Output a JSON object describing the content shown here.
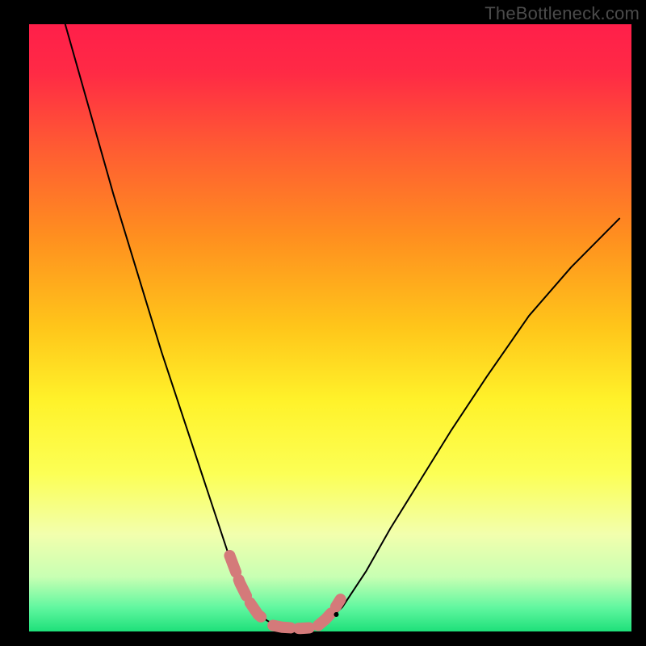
{
  "watermark": "TheBottleneck.com",
  "chart_data": {
    "type": "line",
    "title": "",
    "xlabel": "",
    "ylabel": "",
    "xlim": [
      0,
      100
    ],
    "ylim": [
      0,
      100
    ],
    "gradient_stops": [
      {
        "offset": 0.0,
        "color": "#ff1f4a"
      },
      {
        "offset": 0.08,
        "color": "#ff2a45"
      },
      {
        "offset": 0.2,
        "color": "#ff5a33"
      },
      {
        "offset": 0.35,
        "color": "#ff8f1f"
      },
      {
        "offset": 0.5,
        "color": "#ffc61a"
      },
      {
        "offset": 0.62,
        "color": "#fff22a"
      },
      {
        "offset": 0.74,
        "color": "#fcff55"
      },
      {
        "offset": 0.84,
        "color": "#f2ffad"
      },
      {
        "offset": 0.91,
        "color": "#c8ffb3"
      },
      {
        "offset": 0.96,
        "color": "#62f7a0"
      },
      {
        "offset": 1.0,
        "color": "#1ee07a"
      }
    ],
    "series": [
      {
        "name": "bottleneck-curve",
        "color": "#000000",
        "stroke_width": 2,
        "x": [
          6,
          10,
          14,
          18,
          22,
          26,
          29,
          31,
          33,
          35,
          36.5,
          38,
          39.5,
          41,
          43,
          45,
          47,
          49,
          52,
          56,
          60,
          65,
          70,
          76,
          83,
          90,
          98
        ],
        "y": [
          100,
          86,
          72,
          59,
          46,
          34,
          25,
          19,
          13,
          8,
          5,
          3,
          1.8,
          1.0,
          0.6,
          0.5,
          0.6,
          1.2,
          4,
          10,
          17,
          25,
          33,
          42,
          52,
          60,
          68
        ]
      },
      {
        "name": "pink-dash-left",
        "color": "#d47a7a",
        "stroke_width": 14,
        "dash": "22 10",
        "x": [
          33.3,
          35.0,
          36.5,
          38.0,
          39.5
        ],
        "y": [
          12.5,
          8.0,
          5.0,
          2.8,
          1.6
        ]
      },
      {
        "name": "pink-dash-bottom",
        "color": "#d47a7a",
        "stroke_width": 14,
        "dash": "22 10",
        "x": [
          40.5,
          42.0,
          43.5,
          45.0,
          46.5
        ],
        "y": [
          1.0,
          0.7,
          0.6,
          0.5,
          0.6
        ]
      },
      {
        "name": "pink-dash-right",
        "color": "#d47a7a",
        "stroke_width": 14,
        "dash": "22 10",
        "x": [
          48.0,
          49.2,
          50.5,
          51.7
        ],
        "y": [
          1.0,
          2.0,
          3.4,
          5.3
        ]
      }
    ],
    "annotations": [
      {
        "type": "dot",
        "x": 51.0,
        "y": 2.8,
        "r": 3,
        "color": "#000000"
      }
    ]
  }
}
